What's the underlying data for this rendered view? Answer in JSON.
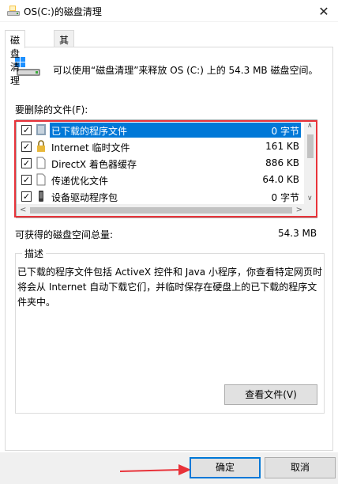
{
  "window": {
    "title": "OS(C:)的磁盘清理",
    "close_glyph": "✕"
  },
  "tabs": [
    {
      "label": "磁盘清理",
      "active": true
    },
    {
      "label": "其他选项",
      "active": false
    }
  ],
  "summary": {
    "icon": "disk-cleanup-icon",
    "text": "可以使用“磁盘清理”来释放 OS (C:) 上的 54.3 MB 磁盘空间。"
  },
  "files_label": "要删除的文件(F):",
  "files": [
    {
      "checked": true,
      "icon": "download-folder-icon",
      "name": "已下载的程序文件",
      "size": "0 字节",
      "selected": true
    },
    {
      "checked": true,
      "icon": "lock-icon",
      "name": "Internet 临时文件",
      "size": "161 KB",
      "selected": false
    },
    {
      "checked": true,
      "icon": "file-icon",
      "name": "DirectX 着色器缓存",
      "size": "886 KB",
      "selected": false
    },
    {
      "checked": true,
      "icon": "file-icon",
      "name": "传递优化文件",
      "size": "64.0 KB",
      "selected": false
    },
    {
      "checked": true,
      "icon": "device-icon",
      "name": "设备驱动程序包",
      "size": "0 字节",
      "selected": false
    }
  ],
  "total": {
    "label": "可获得的磁盘空间总量:",
    "value": "54.3 MB"
  },
  "description": {
    "title": "描述",
    "text": "已下载的程序文件包括 ActiveX 控件和 Java 小程序，你查看特定网页时将会从 Internet 自动下载它们，并临时保存在硬盘上的已下载的程序文件夹中。",
    "view_files_label": "查看文件(V)"
  },
  "buttons": {
    "ok": "确定",
    "cancel": "取消"
  },
  "colors": {
    "selection": "#0078d7",
    "highlight_box": "#e8333a",
    "annotation_arrow": "#e8333a"
  }
}
